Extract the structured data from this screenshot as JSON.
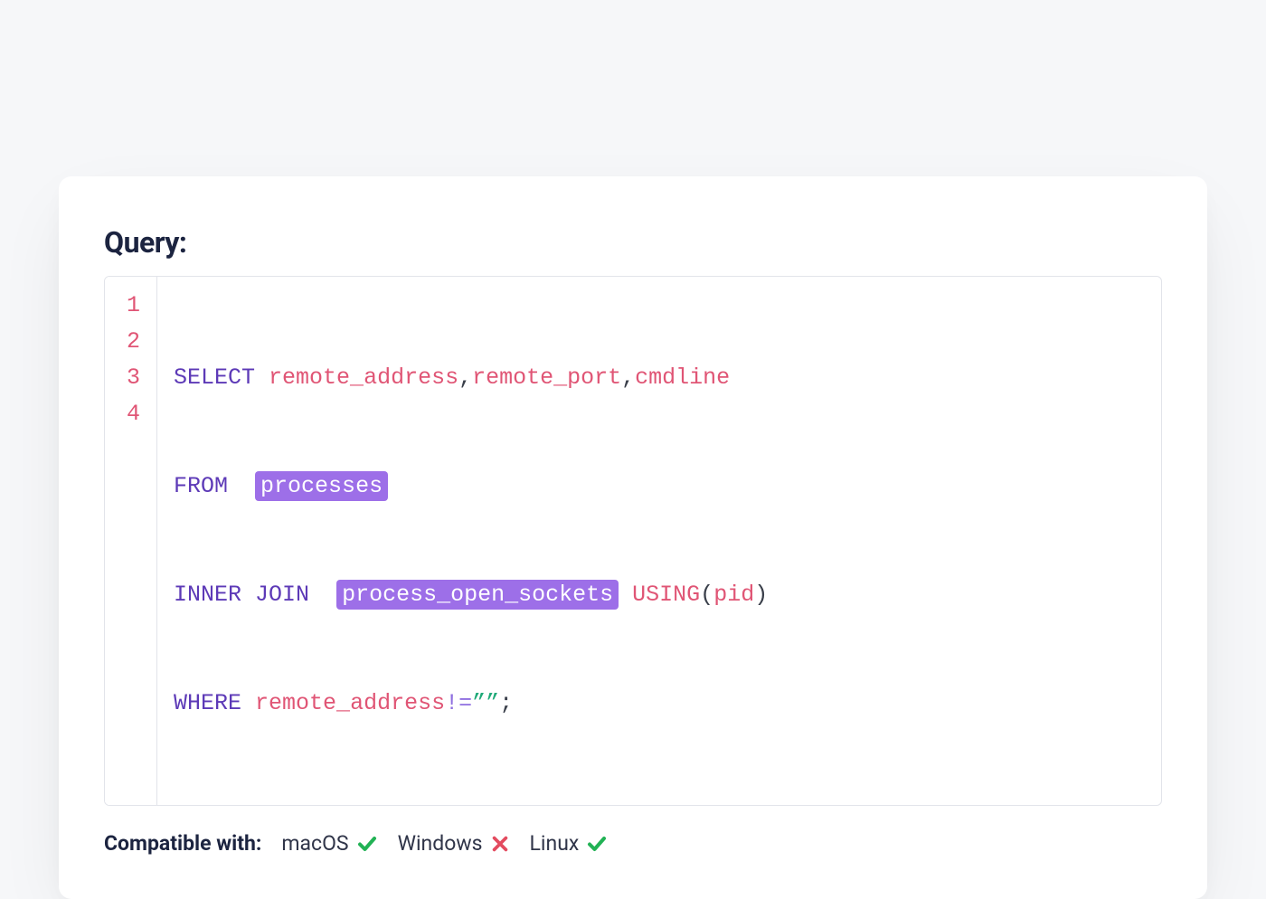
{
  "title": "Query:",
  "code": {
    "line_numbers": [
      "1",
      "2",
      "3",
      "4"
    ],
    "line1": {
      "kw_select": "SELECT",
      "col1": "remote_address",
      "comma1": ",",
      "col2": "remote_port",
      "comma2": ",",
      "col3": "cmdline"
    },
    "line2": {
      "kw_from": "FROM",
      "table1": "processes"
    },
    "line3": {
      "kw_inner": "INNER",
      "kw_join": "JOIN",
      "table2": "process_open_sockets",
      "kw_using": "USING",
      "lparen": "(",
      "join_col": "pid",
      "rparen": ")"
    },
    "line4": {
      "kw_where": "WHERE",
      "where_col": "remote_address",
      "op": "!=",
      "str": "””",
      "semi": ";"
    }
  },
  "compat": {
    "label": "Compatible with:",
    "items": [
      {
        "name": "macOS",
        "ok": true
      },
      {
        "name": "Windows",
        "ok": false
      },
      {
        "name": "Linux",
        "ok": true
      }
    ]
  },
  "colors": {
    "keyword": "#5d3ab7",
    "identifier": "#e05575",
    "highlight_bg": "#9d6fe8",
    "string": "#1fa978",
    "check": "#22b255",
    "cross": "#e34b5f"
  }
}
